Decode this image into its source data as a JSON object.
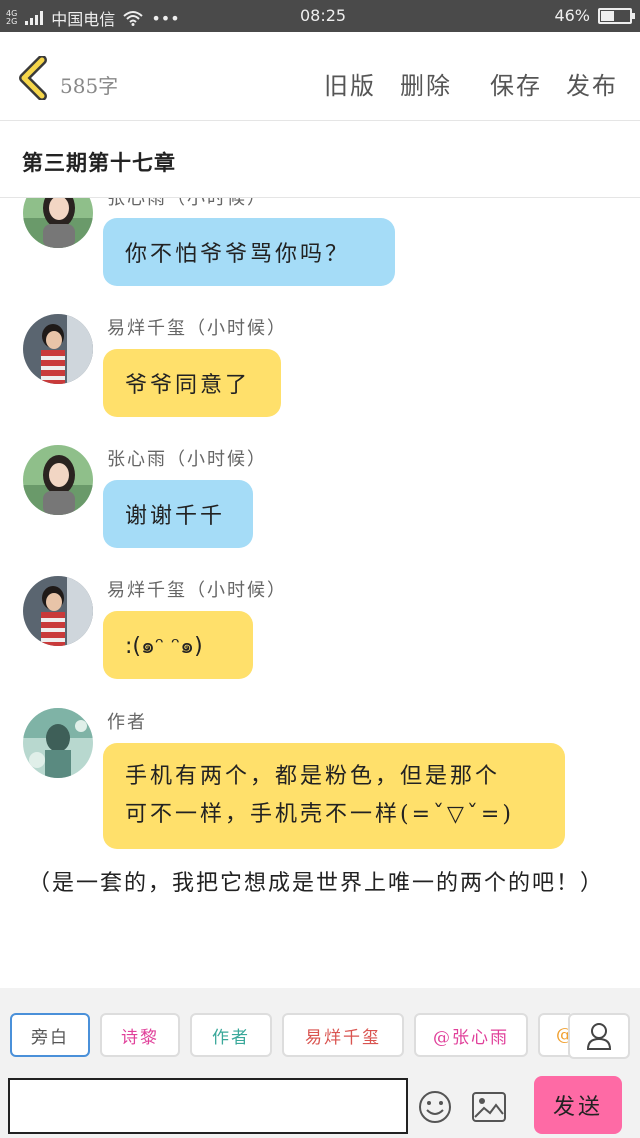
{
  "status": {
    "net_top": "4G",
    "net_bottom": "2G",
    "carrier": "中国电信",
    "more": "•••",
    "time": "08:25",
    "battery": "46%",
    "battery_level": 0.46
  },
  "header": {
    "word_count": "585字",
    "actions": [
      "旧版",
      "删除",
      "保存",
      "发布"
    ]
  },
  "title": "第三期第十七章",
  "messages": [
    {
      "name": "张心雨（小时候）",
      "text": "你不怕爷爷骂你吗？",
      "color": "blue",
      "avatar": "girl"
    },
    {
      "name": "易烊千玺（小时候）",
      "text": "爷爷同意了",
      "color": "yellow",
      "avatar": "boy"
    },
    {
      "name": "张心雨（小时候）",
      "text": "谢谢千千",
      "color": "blue",
      "avatar": "girl"
    },
    {
      "name": "易烊千玺（小时候）",
      "text": ":(๑ᵔ  ᵔ๑)",
      "color": "yellow",
      "avatar": "boy"
    },
    {
      "name": "作者",
      "text_line1": "手机有两个，都是粉色，但是那个",
      "text_line2": "可不一样，手机壳不一样(=ˇ▽ˇ=)",
      "color": "yellow",
      "avatar": "author"
    }
  ],
  "narration": "（是一套的，我把它想成是世界上唯一的两个的吧！）",
  "tags": [
    {
      "label": "旁白",
      "color": "#555555"
    },
    {
      "label": "诗黎",
      "color": "#e0409a"
    },
    {
      "label": "作者",
      "color": "#3aa89a"
    },
    {
      "label": "易烊千玺",
      "color": "#d9534f"
    },
    {
      "label": "@张心雨",
      "color": "#e0409a"
    },
    {
      "label": "@",
      "color": "#f0a030"
    }
  ],
  "input": {
    "value": "",
    "placeholder": ""
  },
  "send_label": "发送",
  "colors": {
    "bubble_blue": "#a5dcf7",
    "bubble_yellow": "#ffe06b",
    "send": "#fe6aa5",
    "selected_tag": "#4a90d9"
  }
}
